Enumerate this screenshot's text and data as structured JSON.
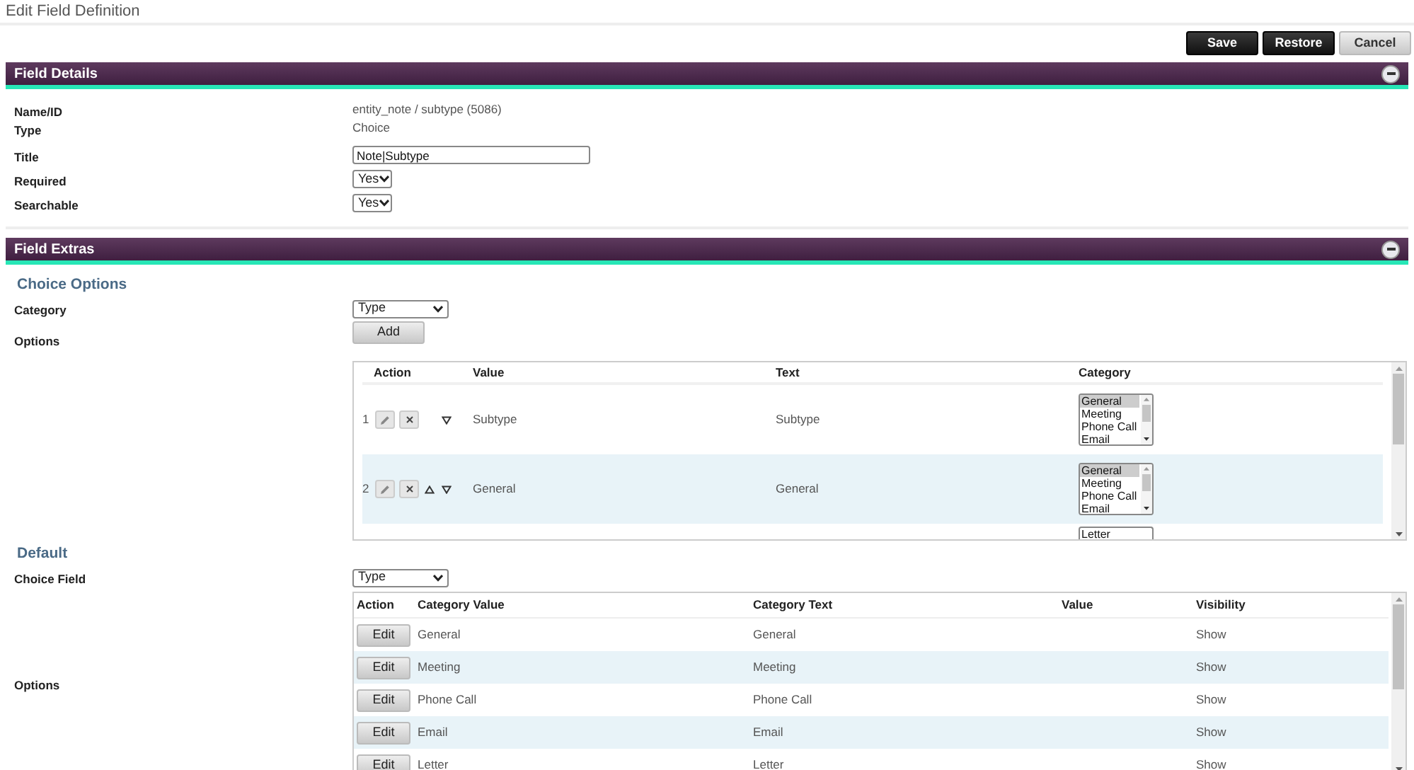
{
  "page_title": "Edit Field Definition",
  "actions": [
    {
      "label": "Save",
      "kind": "dark"
    },
    {
      "label": "Restore",
      "kind": "dark"
    },
    {
      "label": "Cancel",
      "kind": "light"
    }
  ],
  "field_details": {
    "title": "Field Details",
    "expanded": true,
    "rows": [
      {
        "label": "Name/ID",
        "kind": "text",
        "value": "entity_note / subtype (5086)"
      },
      {
        "label": "Type",
        "kind": "text",
        "value": "Choice"
      },
      {
        "label": "Title",
        "kind": "input",
        "value": "Note|Subtype"
      },
      {
        "label": "Required",
        "kind": "select",
        "value": "Yes"
      },
      {
        "label": "Searchable",
        "kind": "select",
        "value": "Yes"
      }
    ]
  },
  "field_extras": {
    "title": "Field Extras",
    "expanded": true,
    "choice_options": {
      "heading": "Choice Options",
      "category_label": "Category",
      "category_value": "Type",
      "options_label": "Options",
      "add_button": "Add",
      "columns": [
        "Action",
        "Value",
        "Text",
        "Category"
      ],
      "rows": [
        {
          "number": "1",
          "move_up": false,
          "move_down": true,
          "value": "Subtype",
          "text": "Subtype",
          "categories": [
            {
              "label": "General",
              "selected": true
            },
            {
              "label": "Meeting",
              "selected": false
            },
            {
              "label": "Phone Call",
              "selected": false
            },
            {
              "label": "Email",
              "selected": false
            }
          ]
        },
        {
          "number": "2",
          "move_up": true,
          "move_down": true,
          "value": "General",
          "text": "General",
          "categories": [
            {
              "label": "General",
              "selected": true
            },
            {
              "label": "Meeting",
              "selected": false
            },
            {
              "label": "Phone Call",
              "selected": false
            },
            {
              "label": "Email",
              "selected": false
            }
          ]
        }
      ],
      "partial_row_category": "Letter"
    },
    "default": {
      "heading": "Default",
      "choice_field_label": "Choice Field",
      "choice_field_value": "Type",
      "options_label": "Options",
      "columns": [
        "Action",
        "Category Value",
        "Category Text",
        "Value",
        "Visibility"
      ],
      "rows": [
        {
          "action": "Edit",
          "category_value": "General",
          "category_text": "General",
          "visibility": "Show"
        },
        {
          "action": "Edit",
          "category_value": "Meeting",
          "category_text": "Meeting",
          "visibility": "Show"
        },
        {
          "action": "Edit",
          "category_value": "Phone Call",
          "category_text": "Phone Call",
          "visibility": "Show"
        },
        {
          "action": "Edit",
          "category_value": "Email",
          "category_text": "Email",
          "visibility": "Show"
        },
        {
          "action": "Edit",
          "category_value": "Letter",
          "category_text": "Letter",
          "visibility": "Show"
        }
      ]
    }
  }
}
